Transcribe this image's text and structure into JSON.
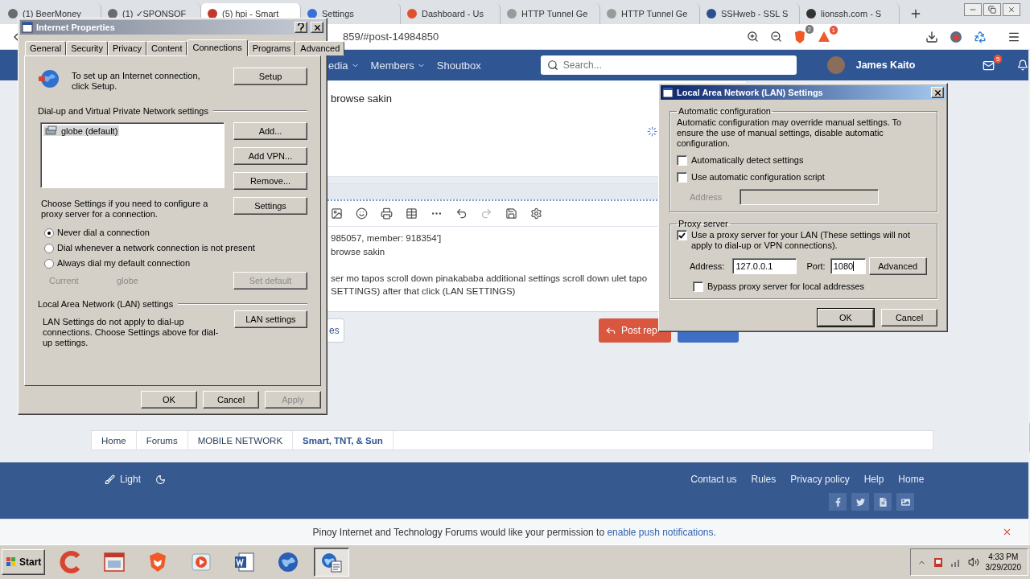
{
  "browser": {
    "tabs": [
      {
        "title": "(1) BeerMoney",
        "selected": false,
        "color": "#6b6b6b"
      },
      {
        "title": "(1) ✓SPONSOF",
        "selected": false,
        "color": "#6b6b6b"
      },
      {
        "title": "(5) hpi - Smart",
        "selected": true,
        "color": "#c0392b"
      },
      {
        "title": "Settings",
        "selected": false,
        "color": "#3b6fd6"
      },
      {
        "title": "Dashboard - Us",
        "selected": false,
        "color": "#e0522f"
      },
      {
        "title": "HTTP Tunnel Ge",
        "selected": false,
        "color": "#9a9a9a"
      },
      {
        "title": "HTTP Tunnel Ge",
        "selected": false,
        "color": "#9a9a9a"
      },
      {
        "title": "SSHweb - SSL S",
        "selected": false,
        "color": "#2a4f8f"
      },
      {
        "title": "lionssh.com - S",
        "selected": false,
        "color": "#333333"
      }
    ],
    "url": "859/#post-14984850",
    "shield_badge": "2",
    "alert_badge": "1"
  },
  "forum_nav": {
    "items": [
      "edia",
      "Members",
      "Shoutbox"
    ],
    "search": {
      "placeholder": "Search..."
    },
    "user": "James Kaito",
    "inbox_badge": "5"
  },
  "post": {
    "text": "browse sakin"
  },
  "editor": {
    "lines": [
      "985057, member: 918354']",
      "browse sakin",
      "ser mo tapos scroll down pinakababa additional settings scroll down ulet tapo",
      "SETTINGS) after that click (LAN SETTINGS)"
    ]
  },
  "reply_buttons": [
    {
      "kind": "plain",
      "label": "es"
    },
    {
      "kind": "primary",
      "label": "Post rep"
    },
    {
      "kind": "secondary"
    }
  ],
  "breadcrumb": [
    {
      "label": "Home",
      "current": false
    },
    {
      "label": "Forums",
      "current": false
    },
    {
      "label": "MOBILE NETWORK",
      "current": false
    },
    {
      "label": "Smart, TNT, & Sun",
      "current": true
    }
  ],
  "footer": {
    "theme": "Light",
    "links": [
      "Contact us",
      "Rules",
      "Privacy policy",
      "Help",
      "Home"
    ]
  },
  "notice": {
    "text": "Pinoy Internet and Technology Forums would like your permission to ",
    "link": "enable push notifications."
  },
  "taskbar": {
    "start": "Start",
    "apps": [
      {
        "kind": "ring",
        "selected": false
      },
      {
        "kind": "window",
        "selected": false
      },
      {
        "kind": "shield",
        "selected": false
      },
      {
        "kind": "play",
        "selected": false
      },
      {
        "kind": "document",
        "selected": false
      },
      {
        "kind": "globe",
        "selected": false
      },
      {
        "kind": "settings",
        "selected": true
      }
    ],
    "time": "4:33 PM",
    "date": "3/29/2020"
  },
  "internet_properties": {
    "title": "Internet Properties",
    "active": false,
    "tabs": [
      {
        "label": "General",
        "selected": false
      },
      {
        "label": "Security",
        "selected": false
      },
      {
        "label": "Privacy",
        "selected": false
      },
      {
        "label": "Content",
        "selected": false
      },
      {
        "label": "Connections",
        "selected": true
      },
      {
        "label": "Programs",
        "selected": false
      },
      {
        "label": "Advanced",
        "selected": false
      }
    ],
    "setup_text": "To set up an Internet connection, click Setup.",
    "setup_button": "Setup",
    "dialup_heading": "Dial-up and Virtual Private Network settings",
    "connections": [
      {
        "name": "globe (default)",
        "selected": true
      }
    ],
    "side_buttons": [
      {
        "label": "Add...",
        "disabled": false
      },
      {
        "label": "Add VPN...",
        "disabled": false
      },
      {
        "label": "Remove...",
        "disabled": false
      }
    ],
    "proxy_hint": "Choose Settings if you need to configure a proxy server for a connection.",
    "settings_button": "Settings",
    "dial_options": [
      {
        "label": "Never dial a connection",
        "selected": true
      },
      {
        "label": "Dial whenever a network connection is not present",
        "selected": false
      },
      {
        "label": "Always dial my default connection",
        "selected": false
      }
    ],
    "current": {
      "label": "Current",
      "value": "globe",
      "disabled": true
    },
    "set_default": {
      "label": "Set default",
      "disabled": true
    },
    "lan_heading": "Local Area Network (LAN) settings",
    "lan_text": "LAN Settings do not apply to dial-up connections. Choose Settings above for dial-up settings.",
    "lan_button": "LAN settings",
    "buttons": [
      {
        "label": "OK",
        "disabled": false
      },
      {
        "label": "Cancel",
        "disabled": false
      },
      {
        "label": "Apply",
        "disabled": true
      }
    ]
  },
  "lan_settings": {
    "title": "Local Area Network (LAN) Settings",
    "active": true,
    "auto_group": {
      "title": "Automatic configuration",
      "note": "Automatic configuration may override manual settings.  To ensure the use of manual settings, disable automatic configuration.",
      "options": [
        {
          "label": "Automatically detect settings",
          "checked": false
        },
        {
          "label": "Use automatic configuration script",
          "checked": false
        }
      ],
      "address_label": "Address",
      "address_disabled": true
    },
    "proxy_group": {
      "title": "Proxy server",
      "use_proxy": {
        "label": "Use a proxy server for your LAN (These settings will not apply to dial-up or VPN connections).",
        "checked": true
      },
      "address_label": "Address:",
      "address": "127.0.0.1",
      "port_label": "Port:",
      "port": "1080",
      "advanced": "Advanced",
      "bypass": {
        "label": "Bypass proxy server for local addresses",
        "checked": false
      }
    },
    "buttons": [
      {
        "label": "OK",
        "default": true
      },
      {
        "label": "Cancel",
        "default": false
      }
    ]
  }
}
